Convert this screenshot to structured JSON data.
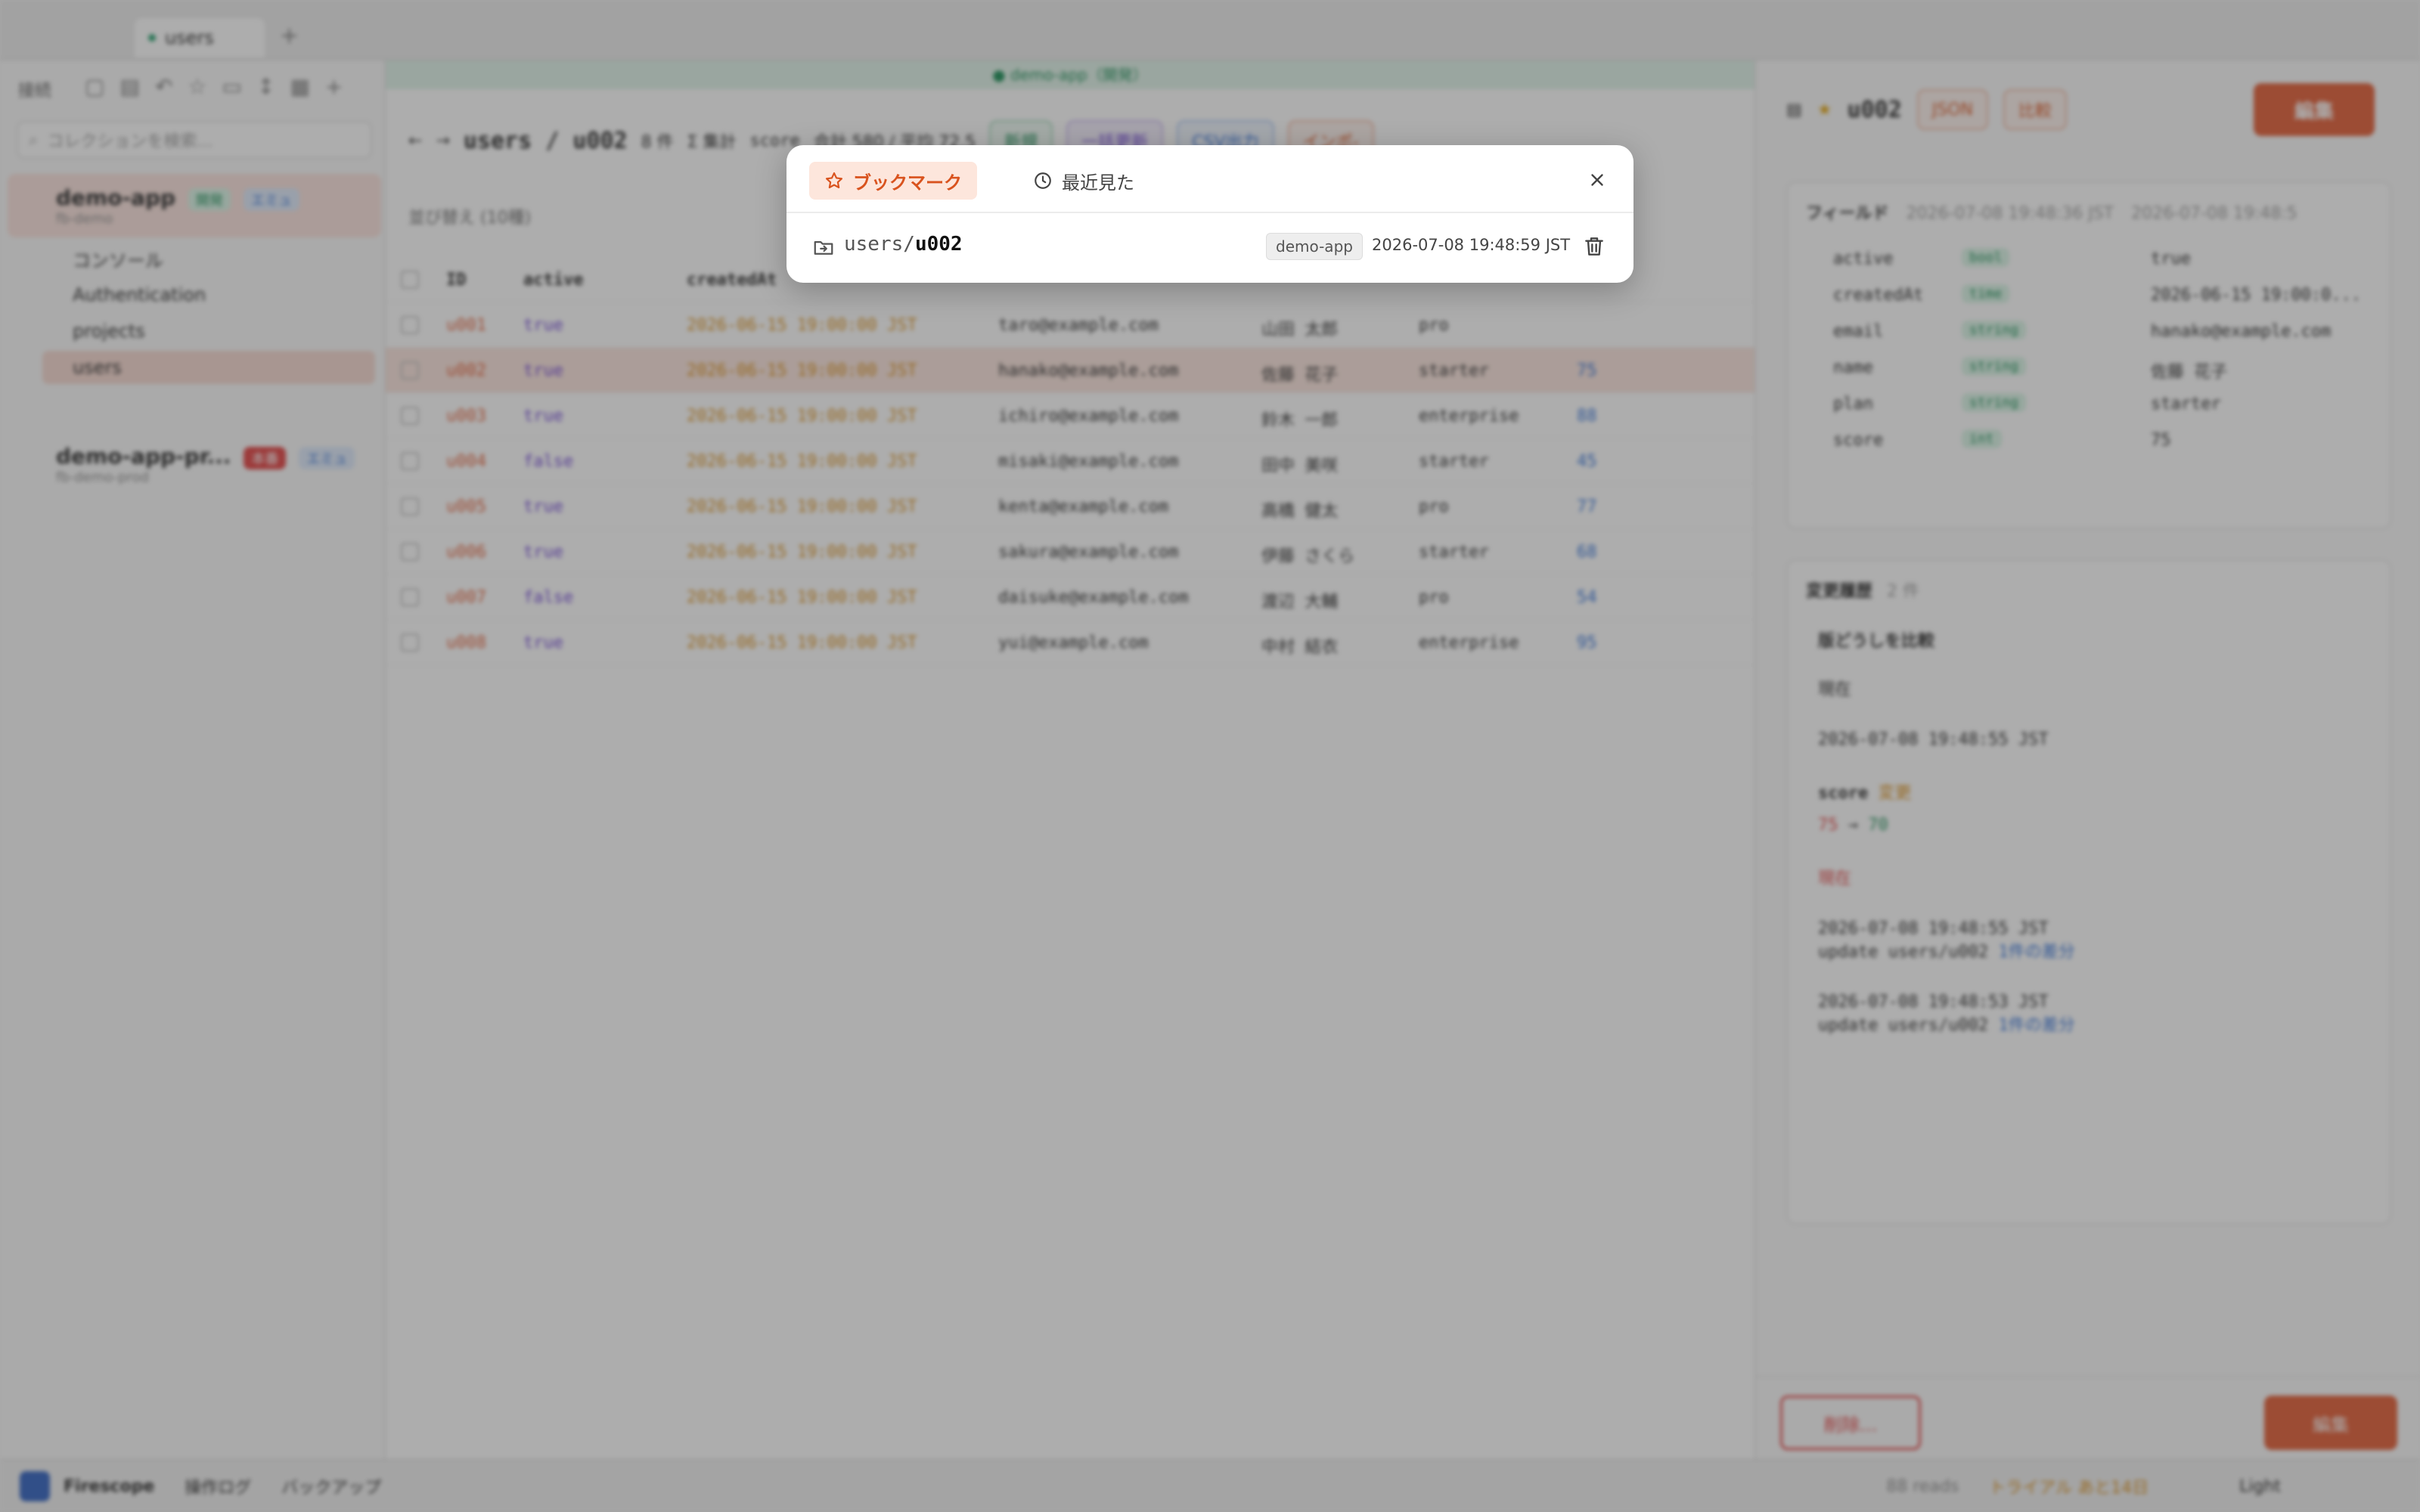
{
  "app": {
    "tab_label": "users",
    "tab_add": "+",
    "sidebar": {
      "heading": "接続",
      "search_placeholder": "コレクションを検索...",
      "projects": [
        {
          "name": "demo-app",
          "id": "fb-demo",
          "badges": [
            "開発",
            "エミュ"
          ]
        },
        {
          "name": "demo-app-pr...",
          "id": "fb-demo-prod",
          "badges": [
            "本番",
            "エミュ"
          ]
        }
      ],
      "tree": [
        "コンソール",
        "Authentication",
        "projects",
        "users"
      ]
    },
    "main": {
      "env_label": "● demo-app（開発）",
      "breadcrumb": "users / u002",
      "count": "8 件",
      "agg_label": "Σ 集計",
      "agg_field": "score",
      "agg_result": "合計 580 / 平均 72.5",
      "buttons": [
        "新規",
        "一括更新",
        "CSV出力",
        "インポ-"
      ],
      "sort_label": "並び替え",
      "sort_value": "(10種)",
      "columns": [
        "ID",
        "active",
        "createdAt",
        "email",
        "name",
        "plan",
        "score"
      ],
      "rows": [
        {
          "id": "u001",
          "active": "true",
          "createdAt": "2026-06-15 19:00:00 JST",
          "email": "taro@example.com",
          "name": "山田 太郎",
          "plan": "pro",
          "score": ""
        },
        {
          "id": "u002",
          "active": "true",
          "createdAt": "2026-06-15 19:00:00 JST",
          "email": "hanako@example.com",
          "name": "佐藤 花子",
          "plan": "starter",
          "score": "75"
        },
        {
          "id": "u003",
          "active": "true",
          "createdAt": "2026-06-15 19:00:00 JST",
          "email": "ichiro@example.com",
          "name": "鈴木 一郎",
          "plan": "enterprise",
          "score": "88"
        },
        {
          "id": "u004",
          "active": "false",
          "createdAt": "2026-06-15 19:00:00 JST",
          "email": "misaki@example.com",
          "name": "田中 美咲",
          "plan": "starter",
          "score": "45"
        },
        {
          "id": "u005",
          "active": "true",
          "createdAt": "2026-06-15 19:00:00 JST",
          "email": "kenta@example.com",
          "name": "高橋 健太",
          "plan": "pro",
          "score": "77"
        },
        {
          "id": "u006",
          "active": "true",
          "createdAt": "2026-06-15 19:00:00 JST",
          "email": "sakura@example.com",
          "name": "伊藤 さくら",
          "plan": "starter",
          "score": "68"
        },
        {
          "id": "u007",
          "active": "false",
          "createdAt": "2026-06-15 19:00:00 JST",
          "email": "daisuke@example.com",
          "name": "渡辺 大輔",
          "plan": "pro",
          "score": "54"
        },
        {
          "id": "u008",
          "active": "true",
          "createdAt": "2026-06-15 19:00:00 JST",
          "email": "yui@example.com",
          "name": "中村 結衣",
          "plan": "enterprise",
          "score": "95"
        }
      ]
    },
    "detail": {
      "title": "u002",
      "json_btn": "JSON",
      "compare_btn": "比較",
      "edit_btn": "編集",
      "fields_heading": "フィールド",
      "created": "2026-07-08 19:48:36 JST",
      "updated": "2026-07-08 19:48:5",
      "fields": [
        {
          "key": "active",
          "type": "bool",
          "value": "true"
        },
        {
          "key": "createdAt",
          "type": "time",
          "value": "2026-06-15 19:00:0..."
        },
        {
          "key": "email",
          "type": "string",
          "value": "hanako@example.com"
        },
        {
          "key": "name",
          "type": "string",
          "value": "佐藤 花子"
        },
        {
          "key": "plan",
          "type": "string",
          "value": "starter"
        },
        {
          "key": "score",
          "type": "int",
          "value": "75"
        }
      ],
      "history_heading": "変更履歴",
      "history_count": "2 件",
      "compare_heading": "版どうしを比較",
      "compare_left": "現在",
      "compare_right": "2026-07-08 19:48:55 JST",
      "diff_field": "score",
      "diff_label": "変更",
      "diff_old": "75",
      "diff_new": "70",
      "current_label": "現在",
      "history": [
        {
          "time": "2026-07-08 19:48:55 JST",
          "desc": "update users/u002",
          "tag": "1件の差分"
        },
        {
          "time": "2026-07-08 19:48:53 JST",
          "desc": "update users/u002",
          "tag": "1件の差分"
        }
      ],
      "delete_btn": "削除...",
      "edit_btn2": "編集"
    },
    "status": {
      "brand": "Firescope",
      "op_log": "操作ログ",
      "backup": "バックアップ",
      "reads": "88 reads",
      "trial": "トライアル あと14日",
      "theme": "Light"
    }
  },
  "modal": {
    "tab_bookmarks": "ブックマーク",
    "tab_recent": "最近見た",
    "items": [
      {
        "path_prefix": "users",
        "sep": "/",
        "doc": "u002",
        "project": "demo-app",
        "time": "2026-07-08 19:48:59 JST"
      }
    ]
  },
  "colors": {
    "accent": "#d9531e",
    "accent_bg": "#fde6dc",
    "overlay": "rgba(60,60,60,0.42)"
  }
}
